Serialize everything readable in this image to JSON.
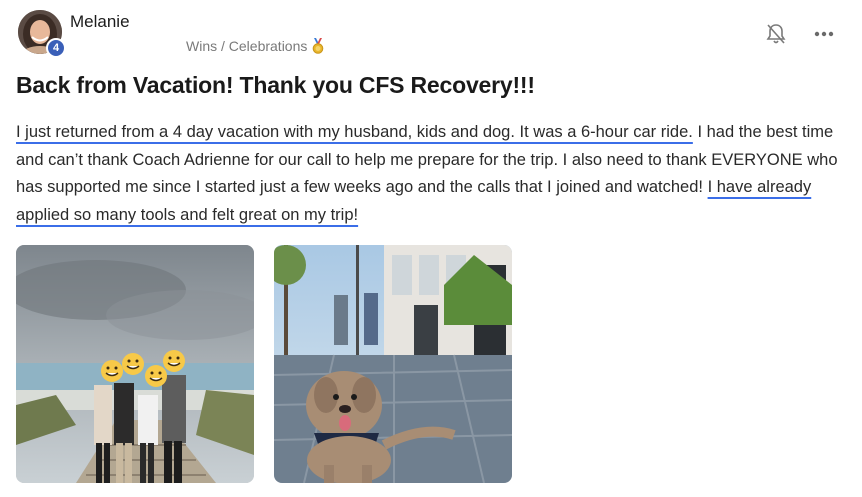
{
  "post": {
    "author": "Melanie",
    "level": "4",
    "category": "Wins / Celebrations",
    "title": "Back from Vacation! Thank you CFS Recovery!!!",
    "body": {
      "hl1": "I just returned from a 4 day vacation with my husband, kids and dog. It was a 6-hour car ride.",
      "mid": " I had the best time and can’t thank Coach Adrienne for our call to help me prepare for the trip. I also need to thank EVERYONE who has supported me since I started just a few weeks ago and the calls that I joined and watched! ",
      "hl2": "I have already applied so many tools and felt great on my trip!"
    }
  },
  "icons": {
    "notification": "bell-off-icon",
    "more": "more-horizontal-icon",
    "category": "medal-icon"
  },
  "colors": {
    "underline": "#3b6ee8",
    "badge": "#3a5fb8"
  }
}
